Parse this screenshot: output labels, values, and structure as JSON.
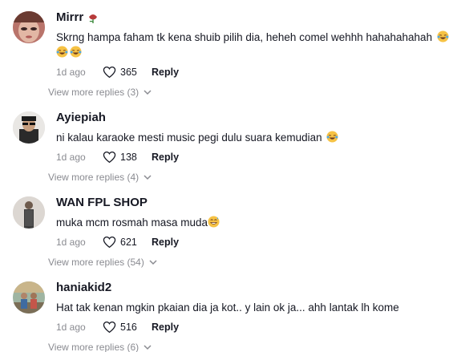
{
  "comments": [
    {
      "username": "Mirrr",
      "badge_icon": "rose-emoji",
      "text": "Skrng hampa faham tk kena shuib pilih dia, heheh comel wehhh hahahahahah",
      "trailing_emoji": "laughing-emoji",
      "trailing_emoji_count": 3,
      "time": "1d ago",
      "likes": "365",
      "reply_label": "Reply",
      "view_more": "View more replies (3)"
    },
    {
      "username": "Ayiepiah",
      "text": "ni kalau karaoke mesti music pegi dulu suara kemudian",
      "trailing_emoji": "laughing-emoji",
      "trailing_emoji_count": 1,
      "time": "1d ago",
      "likes": "138",
      "reply_label": "Reply",
      "view_more": "View more replies (4)"
    },
    {
      "username": "WAN FPL SHOP",
      "text": "muka mcm rosmah masa muda",
      "trailing_emoji": "grinning-sweat-emoji",
      "trailing_emoji_count": 1,
      "time": "1d ago",
      "likes": "621",
      "reply_label": "Reply",
      "view_more": "View more replies (54)"
    },
    {
      "username": "haniakid2",
      "text": "Hat tak kenan mgkin pkaian dia ja kot.. y lain ok ja... ahh lantak lh kome",
      "time": "1d ago",
      "likes": "516",
      "reply_label": "Reply",
      "view_more": "View more replies (6)"
    }
  ],
  "icons": {
    "like": "heart-outline-icon",
    "expand": "chevron-down-icon"
  },
  "colors": {
    "primary_text": "#161823",
    "secondary_text": "#8a8b91",
    "emoji": "#f6c244"
  }
}
